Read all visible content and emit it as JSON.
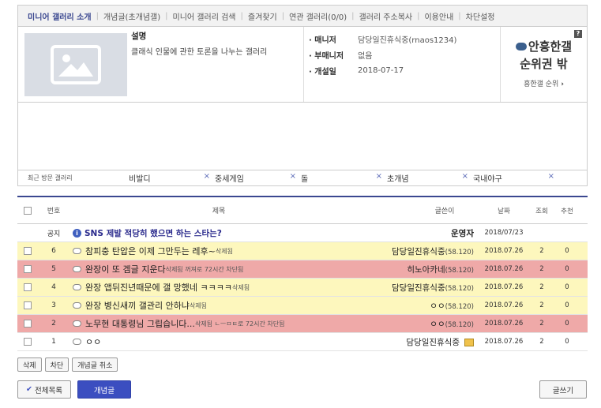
{
  "tabs": [
    {
      "label": "미니어 갤러리 소개",
      "active": true
    },
    {
      "label": "개념글(초개념갤)"
    },
    {
      "label": "미니어 갤러리 검색"
    },
    {
      "label": "즐겨찾기"
    },
    {
      "label": "연관 갤러리(0/0)"
    },
    {
      "label": "갤러리 주소복사"
    },
    {
      "label": "이용안내"
    },
    {
      "label": "차단설정"
    }
  ],
  "info": {
    "thumb_icon": "image-placeholder-icon",
    "desc_title": "설명",
    "desc_text": "클래식 인물에 관한 토론을 나누는 갤러리",
    "manager_label": "매니저",
    "manager_value": "담당일진휴식중(rnaos1234)",
    "submanager_label": "부매니저",
    "submanager_value": "없음",
    "opened_label": "개설일",
    "opened_value": "2018-07-17",
    "help": "?",
    "rank_line1": "안흥한갤",
    "rank_line2": "순위권 밖",
    "rank_link": "흥한갤 순위",
    "rank_arrow": "›"
  },
  "recent": {
    "label": "최근 방문 갤러리",
    "items": [
      "비발디",
      "중세게임",
      "돌",
      "초개념",
      "국내야구"
    ],
    "close": "×"
  },
  "table": {
    "headers": {
      "no": "번호",
      "title": "제목",
      "writer": "글쓴이",
      "date": "날짜",
      "views": "조회",
      "recommend": "추천"
    },
    "notice": {
      "no": "공지",
      "title": "SNS 제발 적당히 했으면 하는 스타는?",
      "writer": "운영자",
      "date": "2018/07/23"
    },
    "rows": [
      {
        "no": "6",
        "title": "참피충 탄압은 이제 그만두는 레후~",
        "tag": "삭제됨",
        "writer": "담당일진휴식중",
        "ip": "(58.120)",
        "date": "2018.07.26",
        "views": "2",
        "rec": "0",
        "color": "yellow"
      },
      {
        "no": "5",
        "title": "완장이 또 겜글 지운다",
        "tag": "삭제됨 꺼져로 72시간 차단됨",
        "writer": "히노아카네",
        "ip": "(58.120)",
        "date": "2018.07.26",
        "views": "2",
        "rec": "0",
        "color": "red"
      },
      {
        "no": "4",
        "title": "완장 앱뒤진년때문에 갤 망했네 ㅋㅋㅋㅋ",
        "tag": "삭제됨",
        "writer": "담당일진휴식중",
        "ip": "(58.120)",
        "date": "2018.07.26",
        "views": "2",
        "rec": "0",
        "color": "yellow"
      },
      {
        "no": "3",
        "title": "완장 병신새끼 갤관리 안하냐",
        "tag": "삭제됨",
        "writer": "ㅇㅇ",
        "ip": "(58.120)",
        "date": "2018.07.26",
        "views": "2",
        "rec": "0",
        "color": "yellow"
      },
      {
        "no": "2",
        "title": "노무현 대통령님 그립습니다...",
        "tag": "삭제됨 ㄴㅡㅁㅌ로 72시간 차단됨",
        "writer": "ㅇㅇ",
        "ip": "(58.120)",
        "date": "2018.07.26",
        "views": "2",
        "rec": "0",
        "color": "red"
      },
      {
        "no": "1",
        "title": "ㅇㅇ",
        "tag": "",
        "writer": "담당일진휴식중",
        "ip": "",
        "date": "2018.07.26",
        "views": "2",
        "rec": "0",
        "color": "white"
      }
    ]
  },
  "buttons": {
    "delete": "삭제",
    "block": "차단",
    "cancel_concept": "개념글 취소",
    "all_list": "전체목록",
    "concept": "개념글",
    "write": "글쓰기",
    "check": "✔"
  }
}
